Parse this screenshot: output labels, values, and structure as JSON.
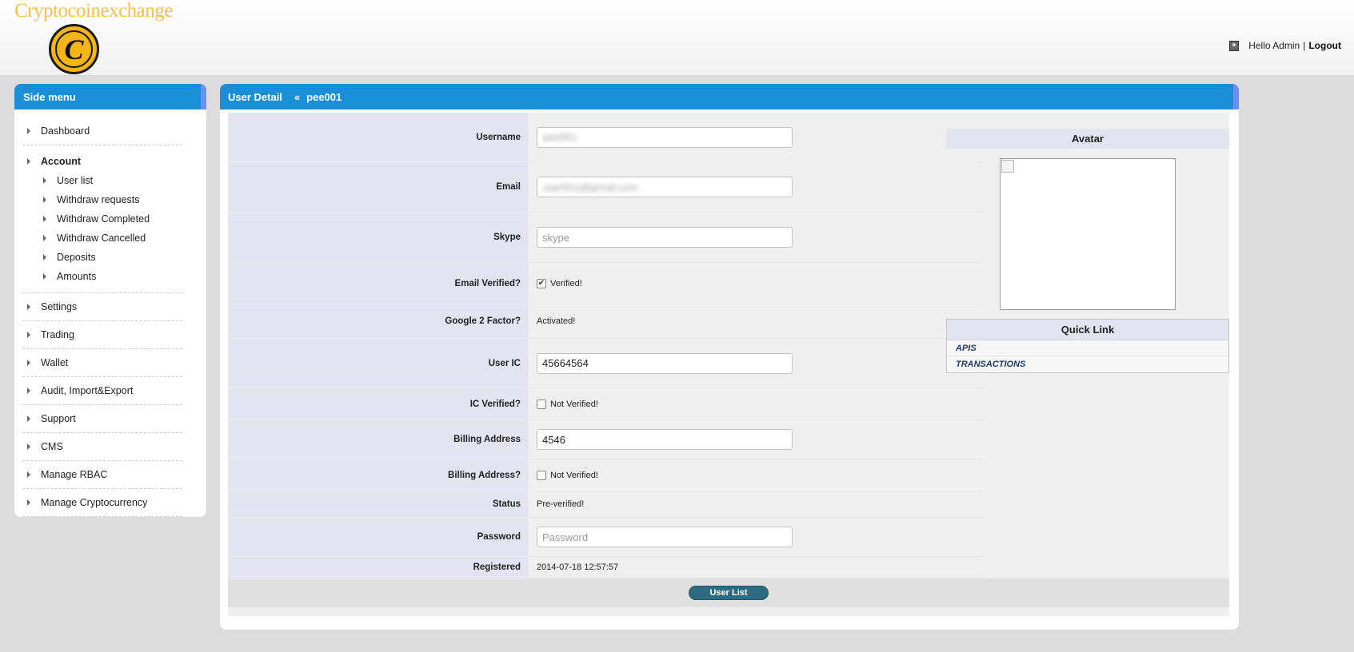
{
  "header": {
    "brand": "Cryptocoinexchange",
    "logo_letter": "C",
    "greeting": "Hello Admin",
    "separator": "|",
    "logout": "Logout"
  },
  "sidebar": {
    "title": "Side menu",
    "items": [
      {
        "label": "Dashboard"
      },
      {
        "label": "Account",
        "children": [
          "User list",
          "Withdraw requests",
          "Withdraw Completed",
          "Withdraw Cancelled",
          "Deposits",
          "Amounts"
        ]
      },
      {
        "label": "Settings"
      },
      {
        "label": "Trading"
      },
      {
        "label": "Wallet"
      },
      {
        "label": "Audit, Import&Export"
      },
      {
        "label": "Support"
      },
      {
        "label": "CMS"
      },
      {
        "label": "Manage RBAC"
      },
      {
        "label": "Manage Cryptocurrency"
      }
    ]
  },
  "main": {
    "title": "User Detail",
    "chevron": "«",
    "user": "pee001",
    "fields": {
      "username": {
        "label": "Username",
        "value": "pee001"
      },
      "email": {
        "label": "Email",
        "value": "user001@gmail.com"
      },
      "skype": {
        "label": "Skype",
        "value": "",
        "placeholder": "skype"
      },
      "email_verified": {
        "label": "Email Verified?",
        "checked": true,
        "text": "Verified!"
      },
      "google2fa": {
        "label": "Google 2 Factor?",
        "value": "Activated!"
      },
      "user_ic": {
        "label": "User IC",
        "value": "45664564"
      },
      "ic_verified": {
        "label": "IC Verified?",
        "checked": false,
        "text": "Not Verified!"
      },
      "billing_address": {
        "label": "Billing Address",
        "value": "4546"
      },
      "billing_verified": {
        "label": "Billing Address?",
        "checked": false,
        "text": "Not Verified!"
      },
      "status": {
        "label": "Status",
        "value": "Pre-verified!"
      },
      "password": {
        "label": "Password",
        "value": "",
        "placeholder": "Password"
      },
      "registered": {
        "label": "Registered",
        "value": "2014-07-18 12:57:57"
      }
    },
    "button": "User List",
    "avatar_title": "Avatar",
    "quick_link": {
      "title": "Quick Link",
      "items": [
        "APIS",
        "TRANSACTIONS"
      ]
    }
  },
  "colors": {
    "panel_header": "#1a8fd8",
    "label_bg": "#e3e3f1",
    "button": "#2d6b80",
    "brand": "#f5c04a",
    "logo": "#f4b51a"
  }
}
